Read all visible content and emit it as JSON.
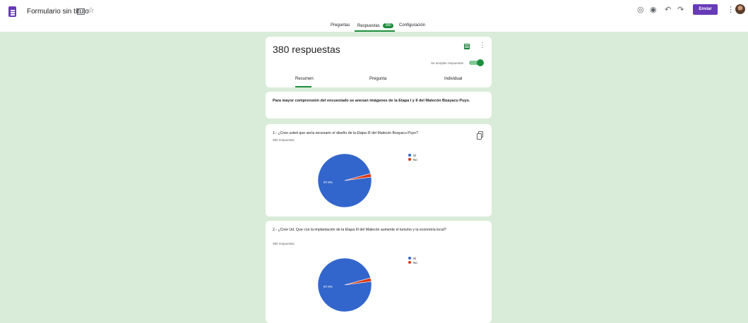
{
  "header": {
    "form_title": "Formulario sin título",
    "send_label": "Enviar",
    "icons": [
      "palette-icon",
      "preview-icon",
      "undo-icon",
      "redo-icon"
    ]
  },
  "tabs": [
    {
      "label": "Preguntas"
    },
    {
      "label": "Respuestas",
      "badge": "380",
      "active": true
    },
    {
      "label": "Configuración"
    }
  ],
  "summary": {
    "title": "380 respuestas",
    "accepting_label": "Se aceptan respuestas",
    "subtabs": [
      "Resumen",
      "Pregunta",
      "Individual"
    ]
  },
  "description": "Para mayor comprensión del encuestado se anexan imágenes de la Etapa I y II del Malecón Boayacu Puyo.",
  "questions": [
    {
      "title": "1.- ¿Cree usted que sería necesario el diseño de la Etapa III del Malecón Boayacu Puyo?",
      "responses_label": "380 respuestas"
    },
    {
      "title": "2.- ¿Cree Ud. Que con la implantación de la Etapa III del Malecón aumente el turismo y la economía local?",
      "responses_label": "380 respuestas"
    }
  ],
  "chart_data": [
    {
      "type": "pie",
      "categories": [
        "Sí",
        "No"
      ],
      "values": [
        97.9,
        2.1
      ],
      "data_labels": [
        "97.9%"
      ],
      "colors": [
        "#3366cc",
        "#dc3912"
      ],
      "legend": "right"
    },
    {
      "type": "pie",
      "categories": [
        "Sí",
        "No"
      ],
      "values": [
        97.9,
        2.1
      ],
      "data_labels": [
        "97.9%"
      ],
      "colors": [
        "#3366cc",
        "#dc3912"
      ],
      "legend": "right"
    }
  ]
}
